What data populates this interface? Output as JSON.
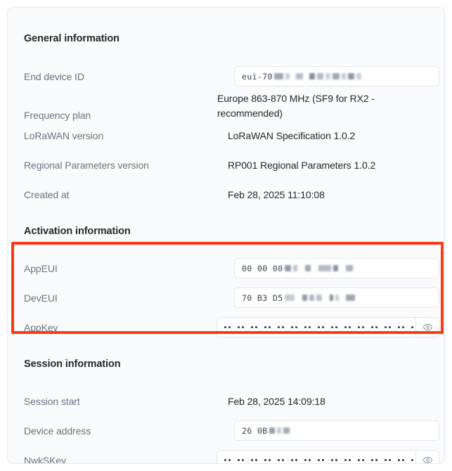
{
  "card": {
    "background": "#fafbfc",
    "border_color": "#e6e9ee"
  },
  "sections": [
    {
      "id": "general",
      "title": "General information"
    },
    {
      "id": "activation",
      "title": "Activation information"
    },
    {
      "id": "session",
      "title": "Session information"
    }
  ],
  "general": {
    "end_device_id": {
      "label": "End device ID",
      "value_prefix": "eui-70",
      "redacted": true
    },
    "frequency_plan": {
      "label": "Frequency plan",
      "value": "Europe 863-870 MHz (SF9 for RX2 - recommended)"
    },
    "lorawan_version": {
      "label": "LoRaWAN version",
      "value": "LoRaWAN Specification 1.0.2"
    },
    "regional_parameters_version": {
      "label": "Regional Parameters version",
      "value": "RP001 Regional Parameters 1.0.2"
    },
    "created_at": {
      "label": "Created at",
      "value": "Feb 28, 2025 11:10:08"
    }
  },
  "activation": {
    "app_eui": {
      "label": "AppEUI",
      "value_prefix": "00 00 00",
      "redacted": true
    },
    "dev_eui": {
      "label": "DevEUI",
      "value_prefix": "70 B3 D5",
      "redacted": true
    },
    "app_key": {
      "label": "AppKey",
      "masked": true,
      "mask_groups": 16,
      "mask_chars_per_group": 2,
      "toggle_icon": "eye-icon"
    }
  },
  "session": {
    "session_start": {
      "label": "Session start",
      "value": "Feb 28, 2025 14:09:18"
    },
    "device_address": {
      "label": "Device address",
      "value_prefix": "26 0B",
      "redacted": true
    },
    "nwk_s_key": {
      "label": "NwkSKey",
      "masked": true,
      "mask_groups": 16,
      "mask_chars_per_group": 2,
      "toggle_icon": "eye-icon"
    }
  },
  "annotation": {
    "highlight_color": "#f93a12",
    "covers": [
      "AppEUI",
      "DevEUI",
      "AppKey"
    ]
  }
}
